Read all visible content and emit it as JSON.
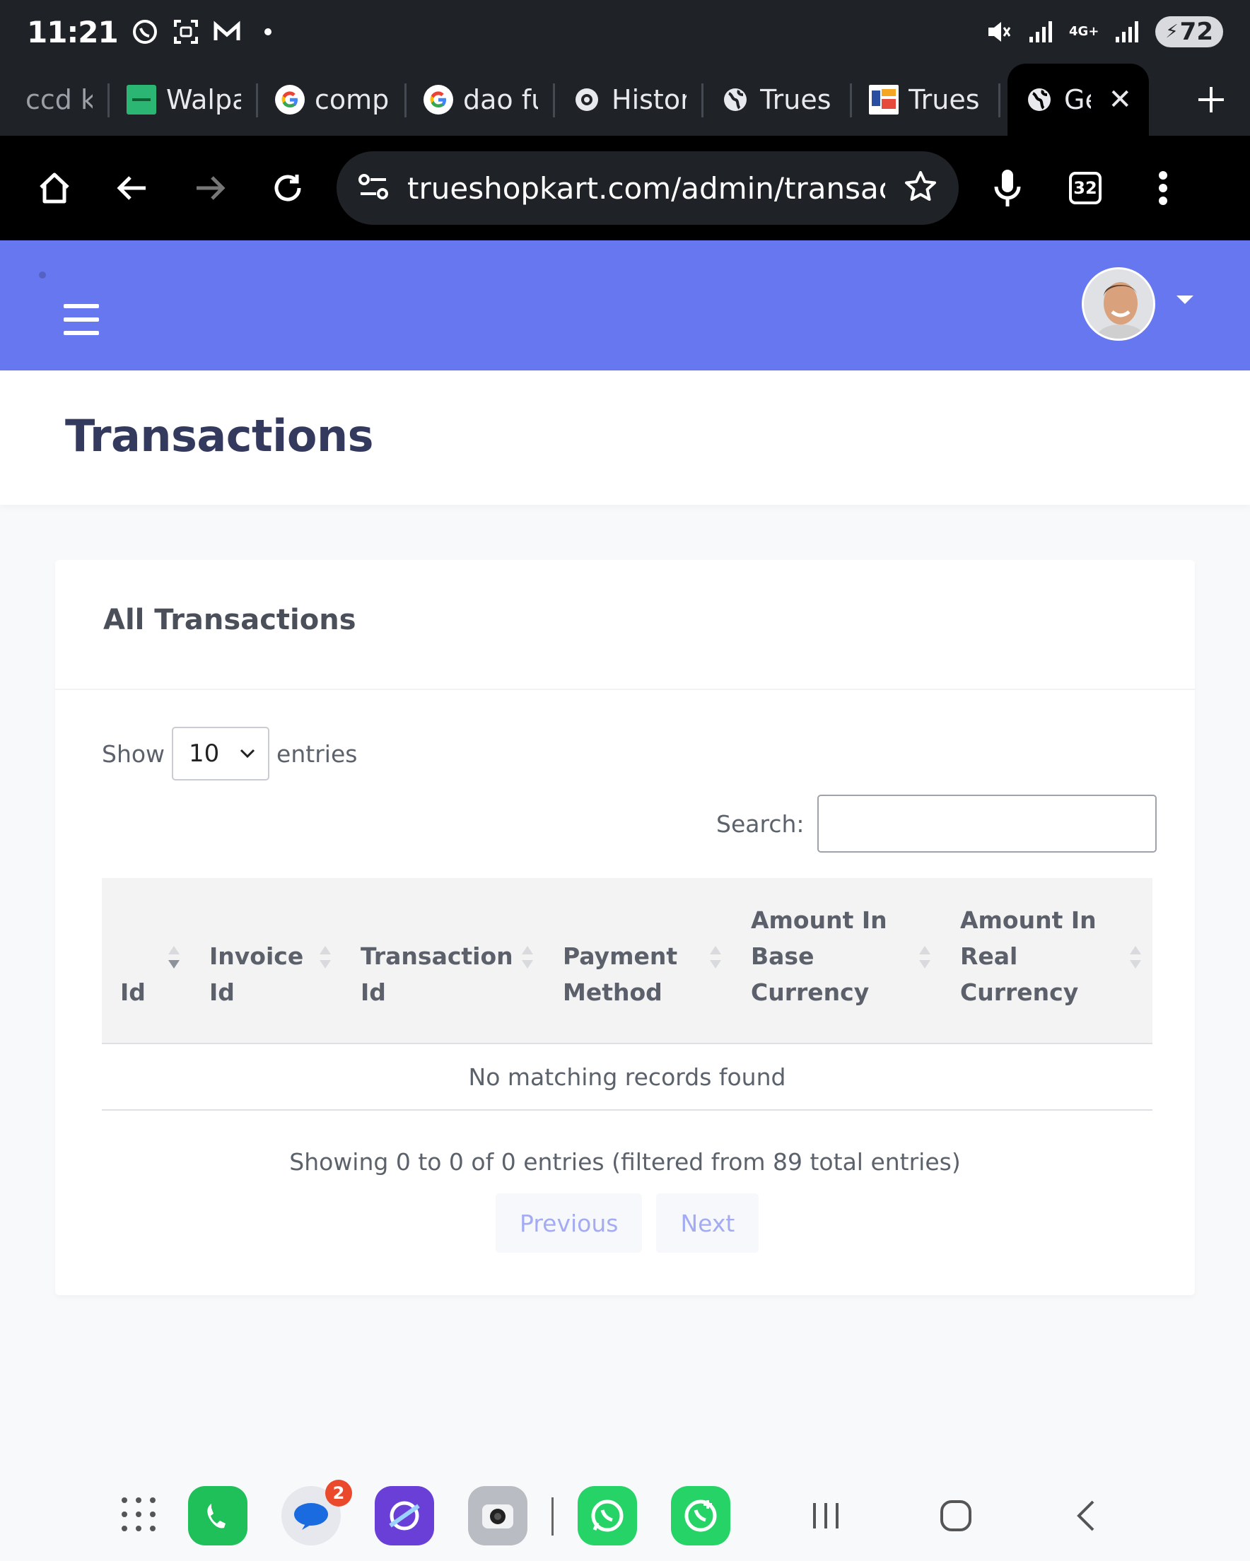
{
  "status_bar": {
    "time": "11:21",
    "battery": "72",
    "network": "4G+",
    "icons": [
      "whatsapp-status-icon",
      "screenshot-icon",
      "gmail-icon",
      "dot-icon",
      "mute-icon",
      "signal-icon",
      "signal-icon"
    ]
  },
  "tabs": [
    {
      "label": "ccd ka",
      "icon": "none"
    },
    {
      "label": "Walpa",
      "icon": "walpa-favicon"
    },
    {
      "label": "comp",
      "icon": "google-favicon"
    },
    {
      "label": "dao fu",
      "icon": "google-favicon"
    },
    {
      "label": "Histor",
      "icon": "history-favicon"
    },
    {
      "label": "Trues",
      "icon": "globe-favicon"
    },
    {
      "label": "Trues",
      "icon": "trueshop-favicon"
    },
    {
      "label": "Ge",
      "icon": "globe-favicon",
      "active": true
    }
  ],
  "toolbar": {
    "url": "trueshopkart.com/admin/transac",
    "tab_count": "32"
  },
  "page": {
    "title": "Transactions"
  },
  "card": {
    "title": "All Transactions",
    "length": {
      "show_label": "Show",
      "selected": "10",
      "entries_label": "entries"
    },
    "search": {
      "label": "Search:",
      "value": "",
      "placeholder": ""
    },
    "table": {
      "columns": [
        {
          "lines": [
            "Id"
          ],
          "sort": "desc"
        },
        {
          "lines": [
            "Invoice",
            "Id"
          ],
          "sort": "none"
        },
        {
          "lines": [
            "Transaction",
            "Id"
          ],
          "sort": "none"
        },
        {
          "lines": [
            "Payment",
            "Method"
          ],
          "sort": "none"
        },
        {
          "lines": [
            "Amount In",
            "Base",
            "Currency"
          ],
          "sort": "none"
        },
        {
          "lines": [
            "Amount In",
            "Real",
            "Currency"
          ],
          "sort": "none"
        }
      ],
      "empty_message": "No matching records found"
    },
    "info": "Showing 0 to 0 of 0 entries (filtered from 89 total entries)",
    "pagination": {
      "previous": "Previous",
      "next": "Next"
    }
  },
  "dock": {
    "apps": [
      "app-drawer-icon",
      "phone-icon",
      "messages-icon",
      "internet-icon",
      "camera-icon",
      "whatsapp-icon",
      "whatsapp-business-icon"
    ],
    "messages_badge": "2"
  },
  "colors": {
    "brand": "#6777ef",
    "title": "#34395e"
  }
}
